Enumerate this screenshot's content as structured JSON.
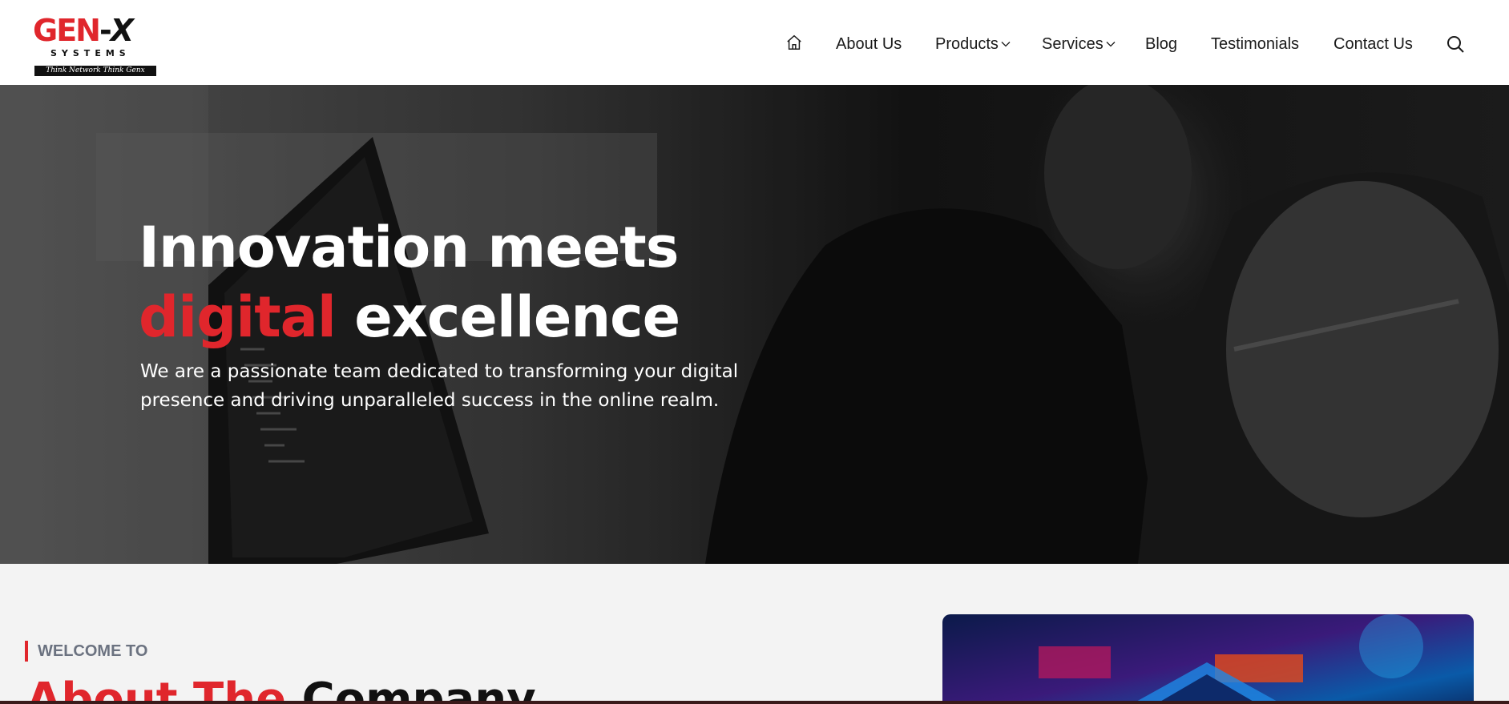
{
  "header": {
    "logo": {
      "brand_main": "GEN",
      "brand_dash": "-",
      "brand_x": "X",
      "brand_sub": "SYSTEMS",
      "tagline": "Think Network Think Genx"
    },
    "nav": {
      "home_icon": "home-icon",
      "items": [
        {
          "label": "About Us"
        },
        {
          "label": "Products",
          "icon": "chevron-down-icon"
        },
        {
          "label": "Services",
          "icon": "chevron-down-icon"
        },
        {
          "label": "Blog"
        },
        {
          "label": "Testimonials"
        },
        {
          "label": "Contact Us"
        }
      ],
      "search_icon": "search-icon"
    }
  },
  "hero": {
    "title_line1": "Innovation meets",
    "title_accent": "digital",
    "title_rest": " excellence",
    "description": "We are a passionate team dedicated to transforming your digital presence and driving unparalleled success in the online realm."
  },
  "about": {
    "eyebrow": "WELCOME TO",
    "title_red": "About The",
    "title_black": " Company"
  },
  "colors": {
    "accent": "#e0262c",
    "text": "#1a1a1a",
    "section_bg": "#f3f3f3"
  }
}
